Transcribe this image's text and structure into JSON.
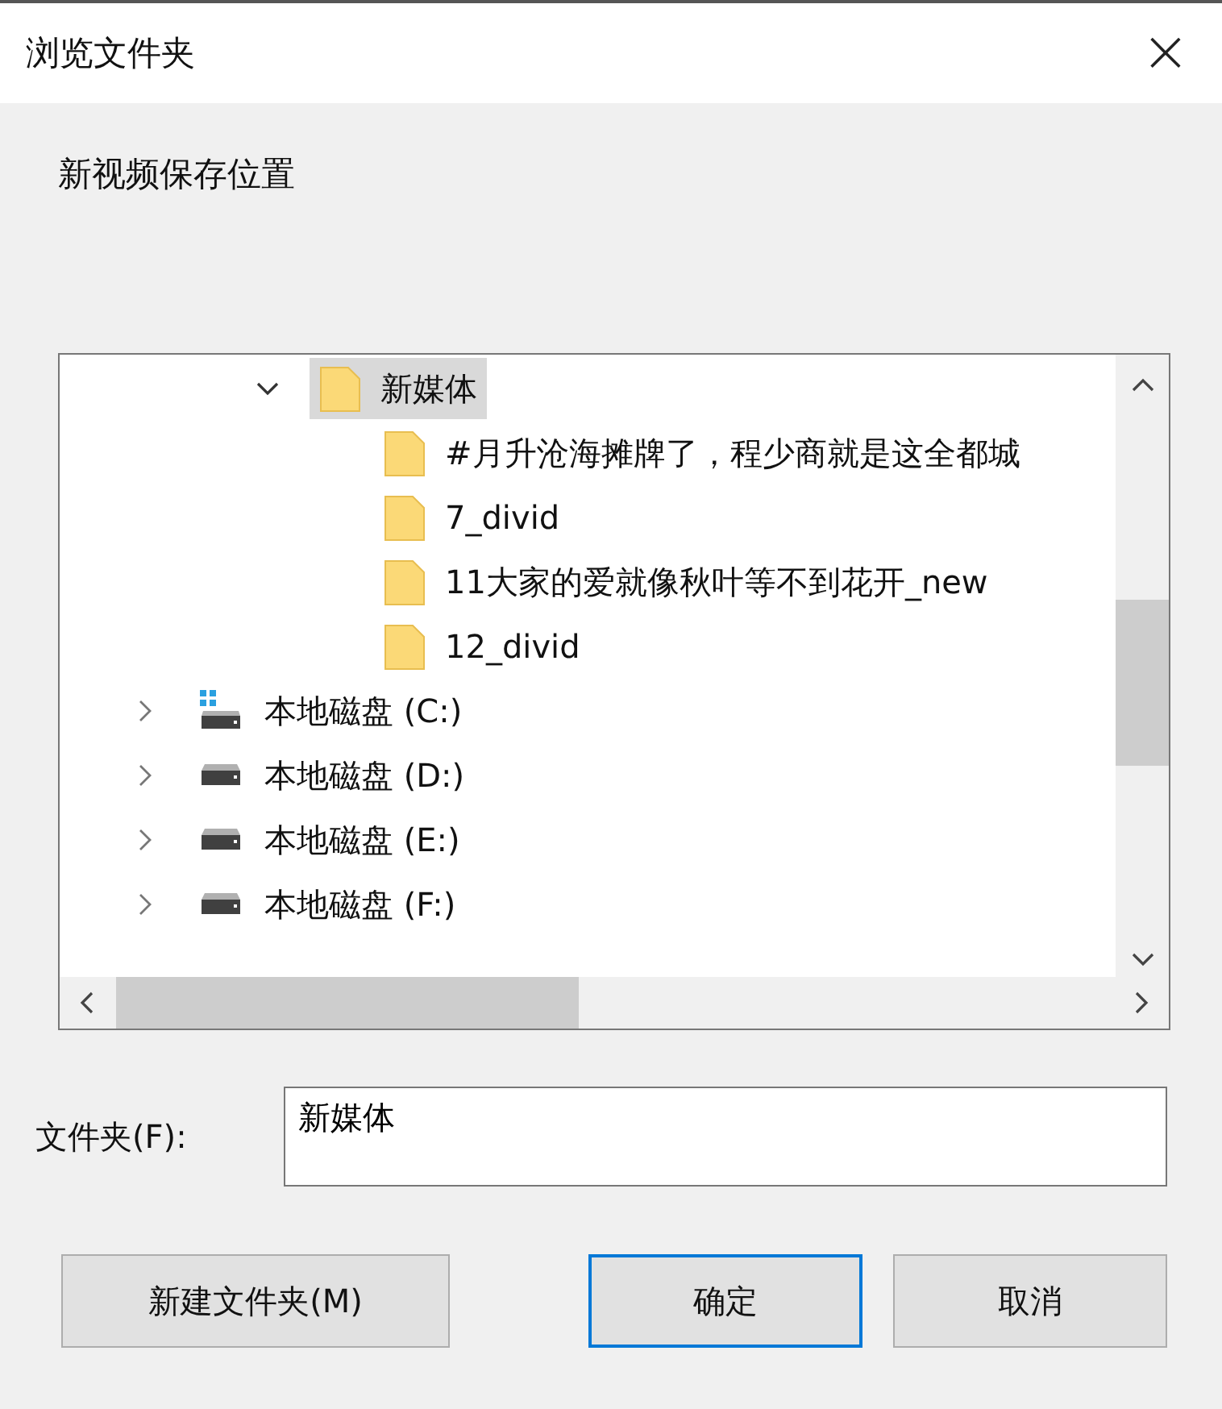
{
  "window": {
    "title": "浏览文件夹",
    "close": "×"
  },
  "instruction": "新视频保存位置",
  "tree": {
    "items": [
      {
        "kind": "folder",
        "label": "新媒体",
        "expanded": true,
        "selected": true,
        "children": [
          {
            "kind": "folder",
            "label": "#月升沧海摊牌了，程少商就是这全都城",
            "selected": false
          },
          {
            "kind": "folder",
            "label": "7_divid",
            "selected": false
          },
          {
            "kind": "folder",
            "label": "11大家的爱就像秋叶等不到花开_new",
            "selected": false
          },
          {
            "kind": "folder",
            "label": "12_divid",
            "selected": false
          }
        ]
      },
      {
        "kind": "system-drive",
        "label": "本地磁盘 (C:)",
        "expanded": false,
        "selected": false
      },
      {
        "kind": "drive",
        "label": "本地磁盘 (D:)",
        "expanded": false,
        "selected": false
      },
      {
        "kind": "drive",
        "label": "本地磁盘 (E:)",
        "expanded": false,
        "selected": false
      },
      {
        "kind": "drive",
        "label": "本地磁盘 (F:)",
        "expanded": false,
        "selected": false
      }
    ]
  },
  "folder_field": {
    "label": "文件夹(F):",
    "value": "新媒体"
  },
  "buttons": [
    {
      "label": "新建文件夹(M)",
      "default": false
    },
    {
      "label": "确定",
      "default": true
    },
    {
      "label": "取消",
      "default": false
    }
  ]
}
